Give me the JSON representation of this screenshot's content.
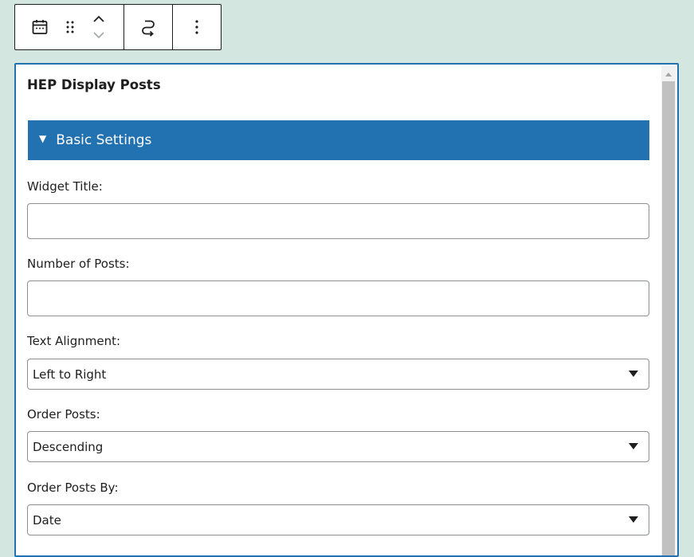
{
  "toolbar": {
    "icons": {
      "block_type": "calendar-icon",
      "drag": "drag-handle-icon",
      "move_up": "chevron-up-icon",
      "move_down": "chevron-down-icon",
      "transform": "transform-icon",
      "options": "more-vertical-icon"
    },
    "colors": {
      "border": "#1e1e1e",
      "disabled": "#a7aaad"
    }
  },
  "panel": {
    "title": "HEP Display Posts",
    "accent_color": "#2271b1",
    "section": {
      "label": "Basic Settings",
      "expanded": true
    },
    "fields": {
      "widget_title": {
        "label": "Widget Title:",
        "value": ""
      },
      "number_of_posts": {
        "label": "Number of Posts:",
        "value": ""
      },
      "text_alignment": {
        "label": "Text Alignment:",
        "value": "Left to Right"
      },
      "order_posts": {
        "label": "Order Posts:",
        "value": "Descending"
      },
      "order_posts_by": {
        "label": "Order Posts By:",
        "value": "Date"
      }
    }
  },
  "page": {
    "background": "#d3e6df"
  }
}
